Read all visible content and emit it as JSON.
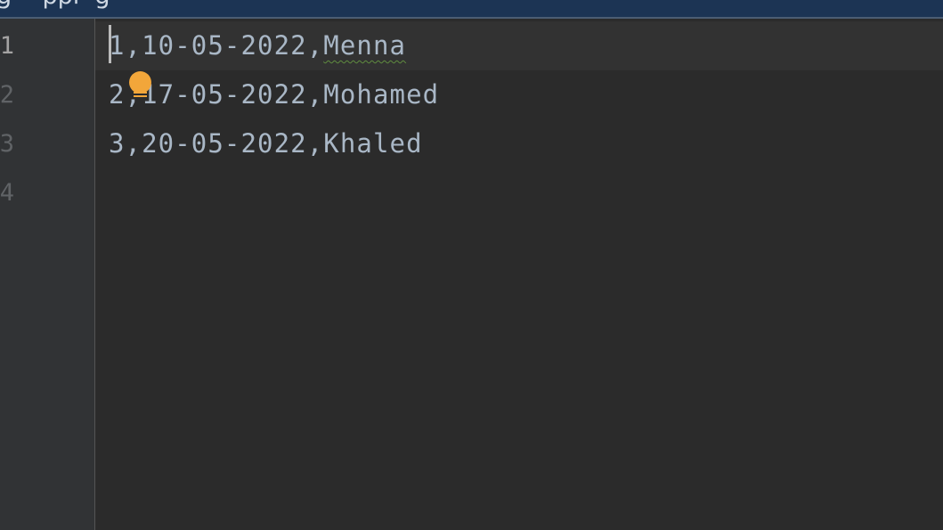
{
  "window": {
    "title_fragment": "g    ppi  g"
  },
  "gutter": {
    "line_numbers": [
      "1",
      "2",
      "3",
      "4"
    ],
    "current_line": "1"
  },
  "editor": {
    "lines": [
      {
        "prefix": "1,10-05-2022,",
        "name": "Menna"
      },
      {
        "prefix": "2,17-05-2022,",
        "name": "Mohamed"
      },
      {
        "prefix": "3,20-05-2022,",
        "name": "Khaled"
      }
    ],
    "inspection_icon": "lightbulb-icon",
    "colors": {
      "background": "#2b2b2b",
      "gutter": "#313335",
      "text": "#a9b7c6",
      "current_line": "#323232",
      "bulb": "#f2a63a",
      "title_bar": "#1c3454"
    }
  }
}
